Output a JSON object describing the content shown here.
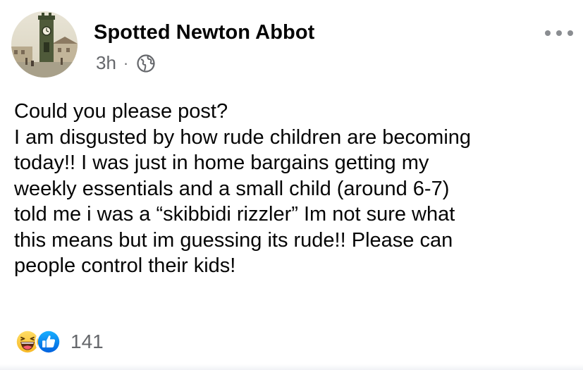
{
  "post": {
    "page_name": "Spotted Newton Abbot",
    "timestamp": "3h",
    "separator": "·",
    "audience_icon": "globe-icon",
    "more_icon": "more-options-icon",
    "avatar_icon": "clock-tower-photo",
    "body_lines": [
      "Could you please post?",
      "I am disgusted by how rude children are becoming",
      "today!! I was just in home bargains getting my",
      "weekly essentials and a small child (around 6-7)",
      "told me i was a “skibbidi rizzler” Im not sure what",
      "this means but im guessing its rude!! Please can",
      "people control their kids!"
    ]
  },
  "reactions": {
    "icons": [
      "haha-icon",
      "like-icon"
    ],
    "count": "141",
    "colors": {
      "like": "#1877f2",
      "haha": "#f7b928"
    }
  }
}
